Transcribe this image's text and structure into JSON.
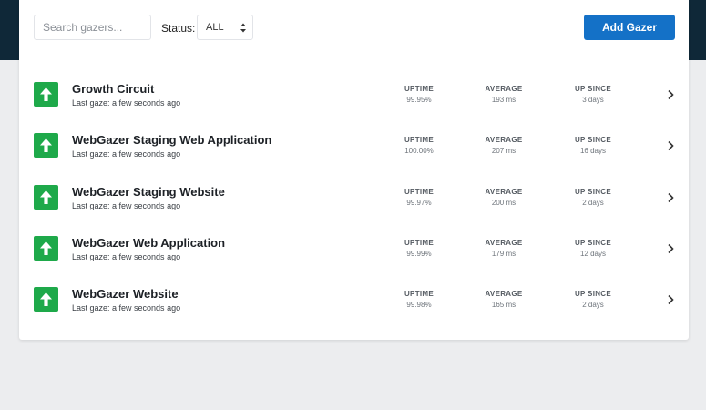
{
  "toolbar": {
    "search_placeholder": "Search gazers...",
    "search_value": "",
    "status_label": "Status:",
    "status_selected": "ALL",
    "add_button_label": "Add Gazer"
  },
  "colors": {
    "top_band": "#0f2838",
    "accent_blue": "#1471c7",
    "status_up_green": "#1ea94a",
    "page_background": "#ecedef"
  },
  "stat_labels": {
    "uptime": "UPTIME",
    "average": "AVERAGE",
    "up_since": "UP SINCE"
  },
  "gazers": [
    {
      "name": "Growth Circuit",
      "last_gaze": "Last gaze: a few seconds ago",
      "uptime": "99.95%",
      "average": "193 ms",
      "up_since": "3 days",
      "status_icon": "arrow-up-icon"
    },
    {
      "name": "WebGazer Staging Web Application",
      "last_gaze": "Last gaze: a few seconds ago",
      "uptime": "100.00%",
      "average": "207 ms",
      "up_since": "16 days",
      "status_icon": "arrow-up-icon"
    },
    {
      "name": "WebGazer Staging Website",
      "last_gaze": "Last gaze: a few seconds ago",
      "uptime": "99.97%",
      "average": "200 ms",
      "up_since": "2 days",
      "status_icon": "arrow-up-icon"
    },
    {
      "name": "WebGazer Web Application",
      "last_gaze": "Last gaze: a few seconds ago",
      "uptime": "99.99%",
      "average": "179 ms",
      "up_since": "12 days",
      "status_icon": "arrow-up-icon"
    },
    {
      "name": "WebGazer Website",
      "last_gaze": "Last gaze: a few seconds ago",
      "uptime": "99.98%",
      "average": "165 ms",
      "up_since": "2 days",
      "status_icon": "arrow-up-icon"
    }
  ]
}
